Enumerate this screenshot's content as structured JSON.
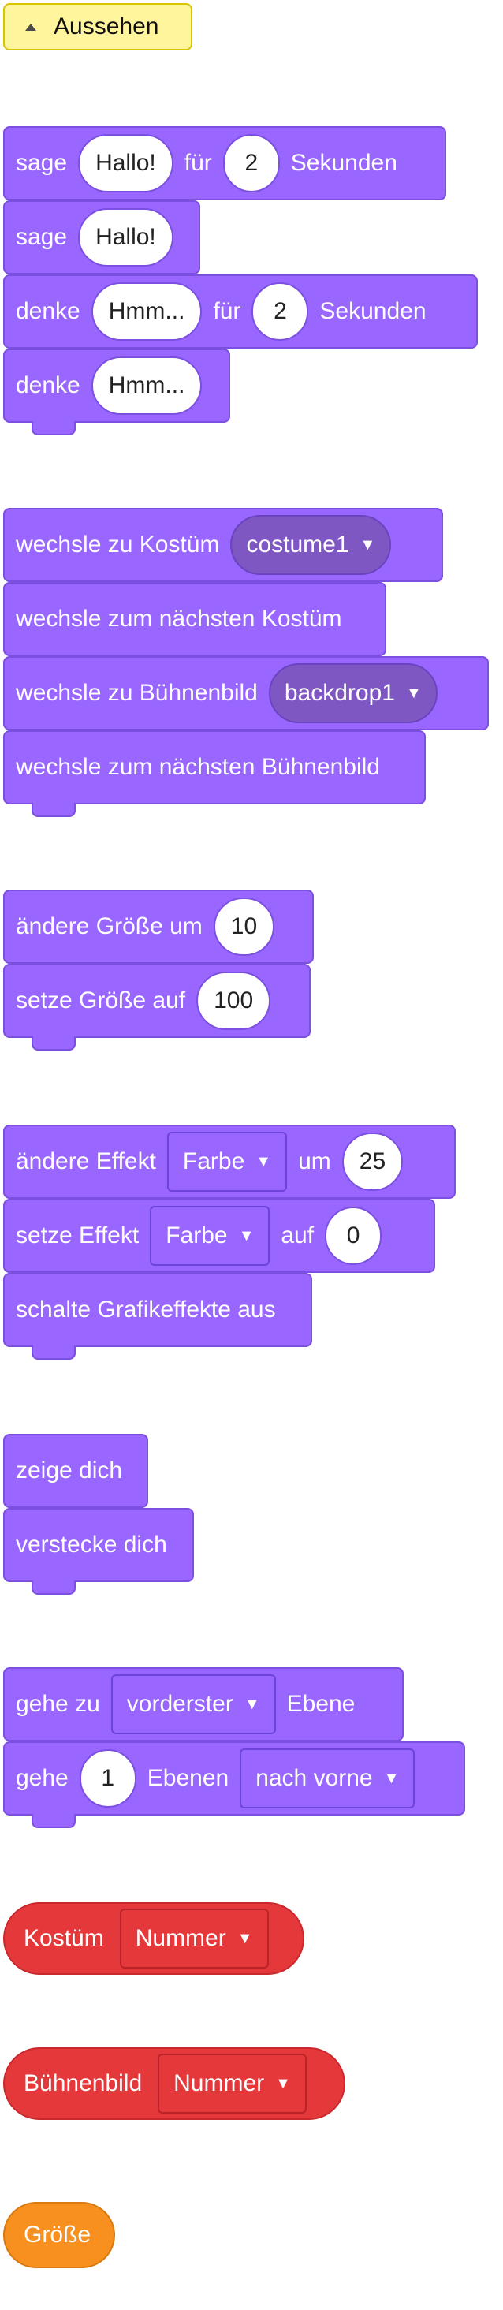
{
  "header": {
    "label": "Aussehen"
  },
  "blocks": {
    "say_for": {
      "w1": "sage",
      "input": "Hallo!",
      "w2": "für",
      "secs": "2",
      "w3": "Sekunden"
    },
    "say": {
      "w1": "sage",
      "input": "Hallo!"
    },
    "think_for": {
      "w1": "denke",
      "input": "Hmm...",
      "w2": "für",
      "secs": "2",
      "w3": "Sekunden"
    },
    "think": {
      "w1": "denke",
      "input": "Hmm..."
    },
    "switch_costume": {
      "text": "wechsle zu Kostüm",
      "value": "costume1"
    },
    "next_costume": {
      "text": "wechsle zum nächsten Kostüm"
    },
    "switch_backdrop": {
      "text": "wechsle zu Bühnenbild",
      "value": "backdrop1"
    },
    "next_backdrop": {
      "text": "wechsle zum nächsten Bühnenbild"
    },
    "change_size": {
      "text": "ändere Größe um",
      "value": "10"
    },
    "set_size": {
      "text": "setze Größe auf",
      "value": "100"
    },
    "change_effect": {
      "text": "ändere Effekt",
      "effect": "Farbe",
      "w2": "um",
      "value": "25"
    },
    "set_effect": {
      "text": "setze Effekt",
      "effect": "Farbe",
      "w2": "auf",
      "value": "0"
    },
    "clear_effects": {
      "text": "schalte Grafikeffekte aus"
    },
    "show": {
      "text": "zeige dich"
    },
    "hide": {
      "text": "verstecke dich"
    },
    "go_to_layer": {
      "w1": "gehe zu",
      "value": "vorderster",
      "w2": "Ebene"
    },
    "go_layers": {
      "w1": "gehe",
      "value": "1",
      "w2": "Ebenen",
      "dir": "nach vorne"
    }
  },
  "reporters": {
    "costume": {
      "text": "Kostüm",
      "value": "Nummer"
    },
    "backdrop": {
      "text": "Bühnenbild",
      "value": "Nummer"
    },
    "size": {
      "text": "Größe"
    }
  },
  "icons": {
    "dropdown": "▼"
  }
}
